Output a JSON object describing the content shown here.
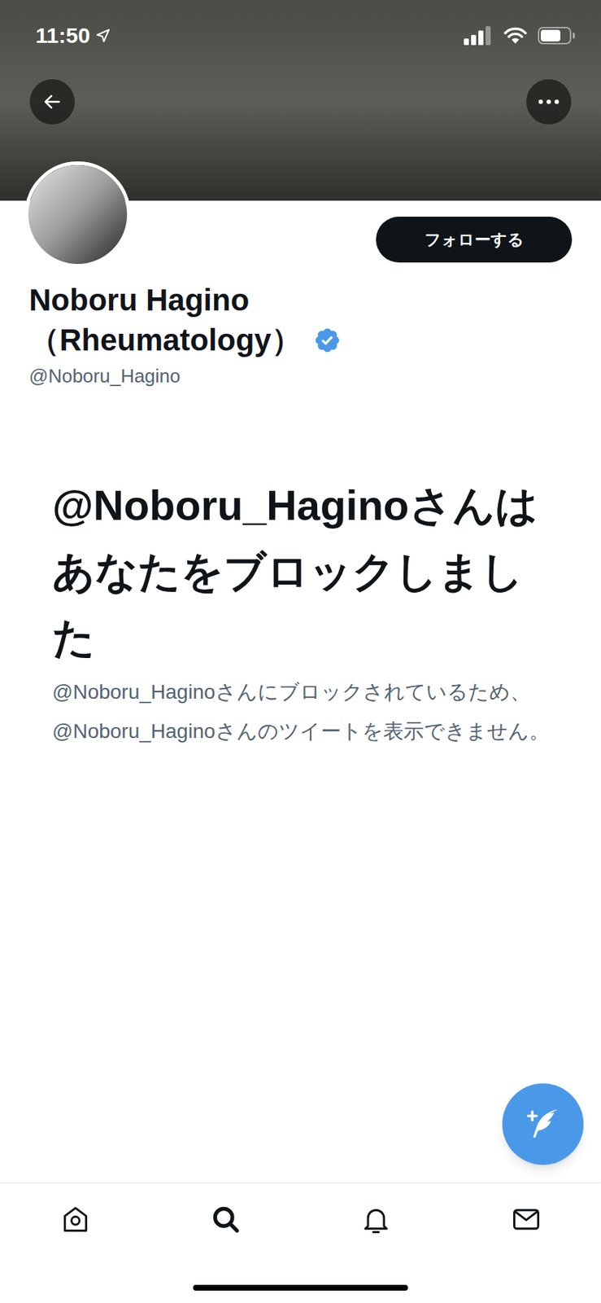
{
  "status_bar": {
    "time": "11:50",
    "battery": {
      "level": 0.7
    }
  },
  "profile": {
    "name": "Noboru Hagino（Rheumatology）",
    "verified": true,
    "handle": "@Noboru_Hagino",
    "follow_button": "フォローする"
  },
  "blocked": {
    "title": "@Noboru_Haginoさんはあなたをブロックしました",
    "message": "@Noboru_Haginoさんにブロックされているため、@Noboru_Haginoさんのツイートを表示できません。"
  },
  "tab_bar": [
    {
      "selected": false
    },
    {
      "selected": true
    },
    {
      "selected": false
    },
    {
      "selected": false
    }
  ]
}
